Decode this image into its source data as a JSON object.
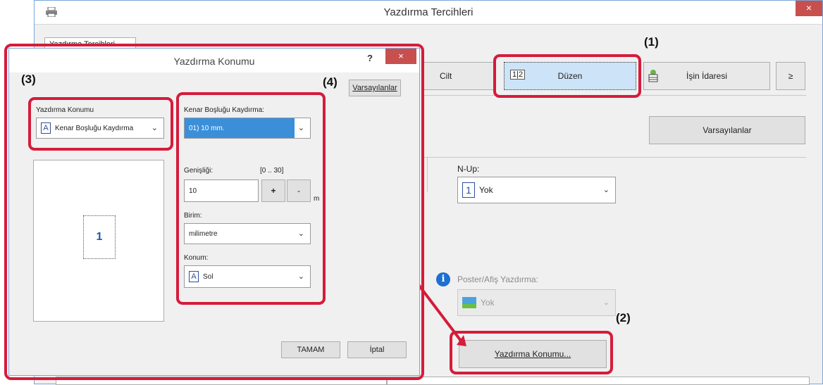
{
  "main_window": {
    "title": "Yazdırma Tercihleri",
    "close_glyph": "×",
    "outer_tab_label": "Yazdırma Tercihleri",
    "tabs": {
      "cilt": "Cilt",
      "duzen": "Düzen",
      "duzen_icon_text": "1|2",
      "is_idaresi": "İşin İdaresi",
      "more": "≥"
    },
    "defaults_button": "Varsayılanlar",
    "nup": {
      "label": "N-Up:",
      "value": "Yok",
      "icon_text": "1"
    },
    "poster": {
      "label": "Poster/Afiş Yazdırma:",
      "value": "Yok",
      "info_glyph": "i"
    },
    "print_position_button": "Yazdırma Konumu..."
  },
  "dialog": {
    "title": "Yazdırma Konumu",
    "help_glyph": "?",
    "close_glyph": "×",
    "defaults_button": "Varsayılanlar",
    "print_position": {
      "label": "Yazdırma Konumu",
      "value": "Kenar Boşluğu Kaydırma",
      "icon_text": "A"
    },
    "preview_page_number": "1",
    "margin_shift": {
      "label": "Kenar Boşluğu Kaydırma:",
      "value": "01) 10 mm."
    },
    "width": {
      "label": "Genişliği:",
      "range": "[0 .. 30]",
      "value": "10",
      "plus": "+",
      "minus": "-",
      "unit_suffix": "m"
    },
    "unit": {
      "label": "Birim:",
      "value": "milimetre"
    },
    "position": {
      "label": "Konum:",
      "value": "Sol",
      "icon_text": "A"
    },
    "ok_button": "TAMAM",
    "cancel_button": "İptal"
  },
  "callouts": {
    "c1": "(1)",
    "c2": "(2)",
    "c3": "(3)",
    "c4": "(4)"
  },
  "colors": {
    "highlight": "#d51c3b",
    "selection": "#3b8fd9",
    "close": "#c7504f"
  }
}
